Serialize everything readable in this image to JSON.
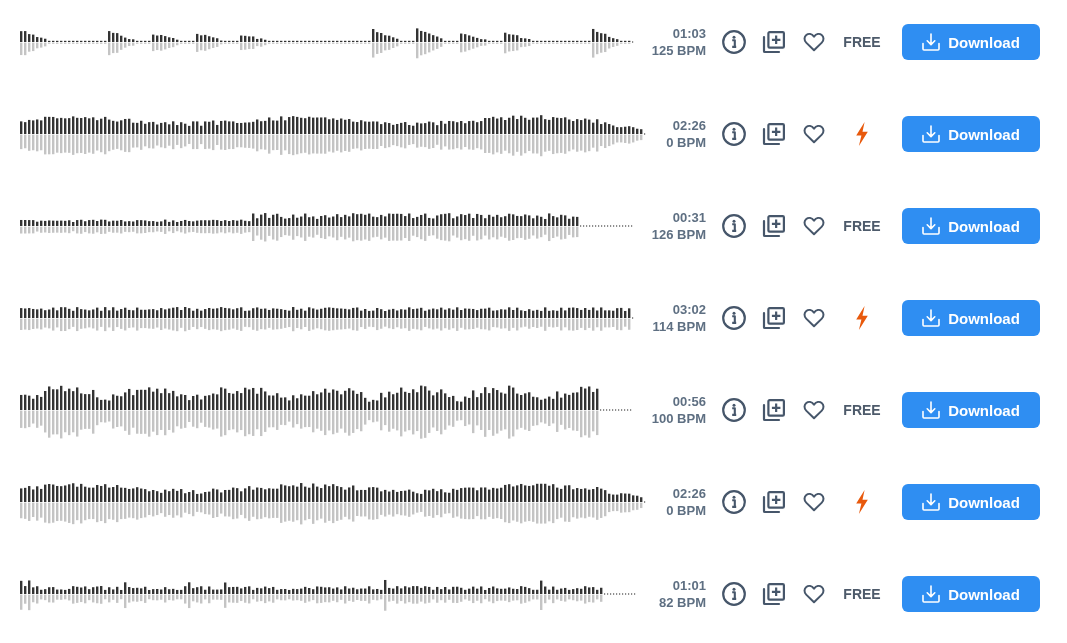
{
  "tracks": [
    {
      "duration": "01:03",
      "bpm": "125 BPM",
      "license": {
        "kind": "free",
        "label": "FREE"
      },
      "download": "Download"
    },
    {
      "duration": "02:26",
      "bpm": "0 BPM",
      "license": {
        "kind": "premium"
      },
      "download": "Download"
    },
    {
      "duration": "00:31",
      "bpm": "126 BPM",
      "license": {
        "kind": "free",
        "label": "FREE"
      },
      "download": "Download"
    },
    {
      "duration": "03:02",
      "bpm": "114 BPM",
      "license": {
        "kind": "premium"
      },
      "download": "Download"
    },
    {
      "duration": "00:56",
      "bpm": "100 BPM",
      "license": {
        "kind": "free",
        "label": "FREE"
      },
      "download": "Download"
    },
    {
      "duration": "02:26",
      "bpm": "0 BPM",
      "license": {
        "kind": "premium"
      },
      "download": "Download"
    },
    {
      "duration": "01:01",
      "bpm": "82 BPM",
      "license": {
        "kind": "free",
        "label": "FREE"
      },
      "download": "Download"
    }
  ]
}
